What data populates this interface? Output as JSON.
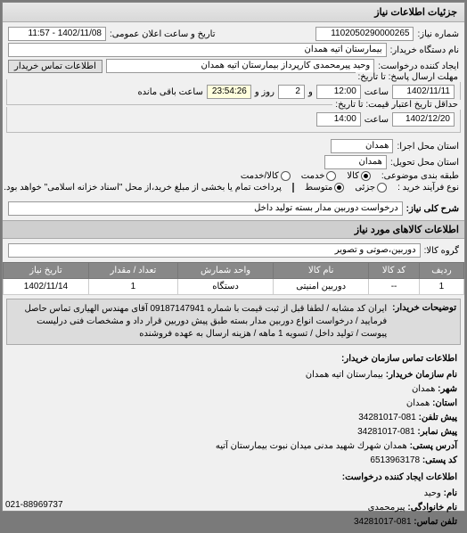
{
  "titlebar": "جزئیات اطلاعات نیاز",
  "header": {
    "req_no_label": "شماره نیاز:",
    "req_no": "1102050290000265",
    "ann_label": "تاریخ و ساعت اعلان عمومی:",
    "ann_value": "1402/11/08 - 11:57",
    "buyer_dev_label": "نام دستگاه خریدار:",
    "buyer_dev": "بیمارستان اتیه همدان",
    "requester_label": "ایجاد کننده درخواست:",
    "requester": "وحید پیرمحمدی کارپرداز بیمارستان اتیه همدان",
    "buyer_contact_btn": "اطلاعات تماس خریدار"
  },
  "deadline": {
    "group_label": "مهلت ارسال پاسخ: تا تاریخ:",
    "date": "1402/11/11",
    "time_label": "ساعت",
    "time": "12:00",
    "and": "و",
    "days": "2",
    "days_label": "روز و",
    "remain": "23:54:26",
    "remain_label": "ساعت باقی مانده"
  },
  "validity": {
    "group_label": "حداقل تاریخ اعتبار قیمت: تا تاریخ:",
    "date": "1402/12/20",
    "time_label": "ساعت",
    "time": "14:00"
  },
  "location": {
    "exec_label": "استان محل اجرا:",
    "province": "همدان",
    "deliv_label": "استان محل تحویل:",
    "province2": "همدان"
  },
  "subject_pkg": {
    "label": "طبقه بندی موضوعی:",
    "opt_goods": "کالا",
    "opt_service": "خدمت",
    "opt_goods_service": "کالا/خدمت"
  },
  "process": {
    "label": "نوع فرآیند خرید :",
    "opt_small": "جزئی",
    "opt_medium": "متوسط",
    "note": "پرداخت تمام یا بخشی از مبلغ خرید،از محل \"اسناد خزانه اسلامی\" خواهد بود.",
    "arrow_icon": "arrow-left-icon"
  },
  "need_title": {
    "label": "شرح کلی نیاز:",
    "value": "درخواست دوربین مدار بسته تولید داخل"
  },
  "goods_header": "اطلاعات کالاهای مورد نیاز",
  "goods_group": {
    "label": "گروه کالا:",
    "value": "دوربین،صوتی و تصویر"
  },
  "table": {
    "headers": [
      "ردیف",
      "کد کالا",
      "نام کالا",
      "واحد شمارش",
      "تعداد / مقدار",
      "تاریخ نیاز"
    ],
    "rows": [
      {
        "idx": "1",
        "code": "--",
        "name": "دوربین امنیتی",
        "unit": "دستگاه",
        "qty": "1",
        "date": "1402/11/14"
      }
    ]
  },
  "buyer_desc": {
    "label": "توضیحات خریدار:",
    "text": "ایران کد مشابه / لطفا قبل از ثبت قیمت با شماره 09187147941 آقای مهندس الهیاری تماس حاصل فرمایید / درخواست انواع دوربین مدار بسته طبق پیش دوربین قرار داد و مشخصات فنی درلیست پیوست / تولید داخل / تسویه 1 ماهه / هزینه ارسال به عهده فروشنده"
  },
  "contacts": {
    "title": "اطلاعات تماس سازمان خریدار:",
    "org_label": "نام سازمان خریدار:",
    "org": "بیمارستان اتیه همدان",
    "city_label": "شهر:",
    "city": "همدان",
    "province_label": "استان:",
    "province": "همدان",
    "phone_label": "پیش تلفن:",
    "phone": "081-34281017",
    "fax_label": "پیش نمابر:",
    "fax": "081-34281017",
    "addr_label": "آدرس پستی:",
    "addr": "همدان شهرك شهید مدنی میدان نبوت بیمارستان آتیه",
    "zip_label": "کد پستی:",
    "zip": "6513963178",
    "req_creator_title": "اطلاعات ایجاد کننده درخواست:",
    "name_label": "نام:",
    "name": "وحید",
    "lname_label": "نام خانوادگی:",
    "lname": "پیرمحمدی",
    "cphone_label": "تلفن تماس:",
    "cphone": "081-34281017"
  },
  "footer_phone": "021-88969737"
}
